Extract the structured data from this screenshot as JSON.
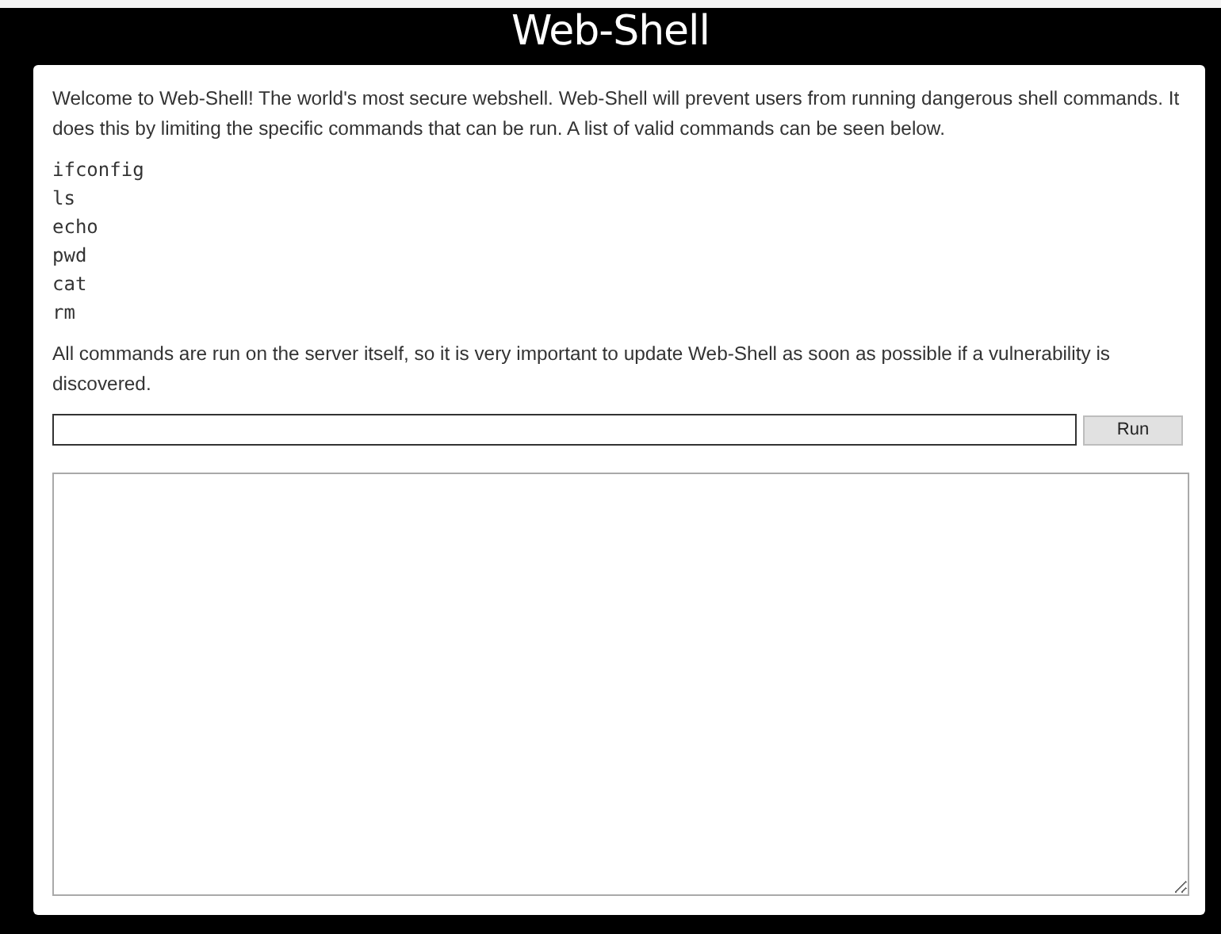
{
  "header": {
    "title": "Web-Shell"
  },
  "intro": "Welcome to Web-Shell! The world's most secure webshell. Web-Shell will prevent users from running dangerous shell commands. It does this by limiting the specific commands that can be run. A list of valid commands can be seen below.",
  "commands": [
    "ifconfig",
    "ls",
    "echo",
    "pwd",
    "cat",
    "rm"
  ],
  "note": "All commands are run on the server itself, so it is very important to update Web-Shell as soon as possible if a vulnerability is discovered.",
  "command_form": {
    "button": "Run"
  }
}
